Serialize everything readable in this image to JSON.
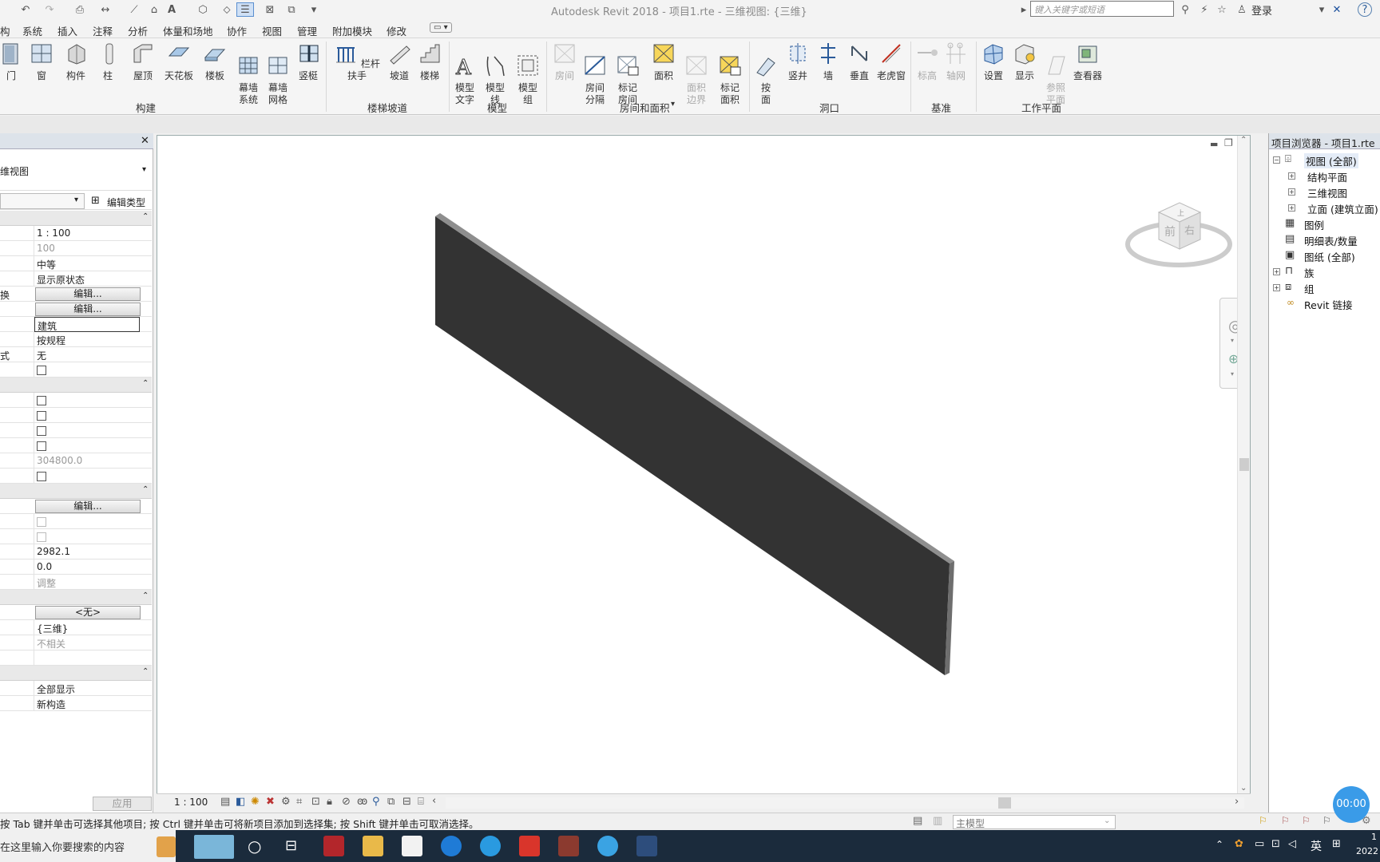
{
  "title_bar": {
    "text": "Autodesk Revit 2018 -    项目1.rte - 三维视图: {三维}",
    "search_placeholder": "键入关键字或短语",
    "login_label": "登录"
  },
  "menu_tabs": [
    "构",
    "系统",
    "插入",
    "注释",
    "分析",
    "体量和场地",
    "协作",
    "视图",
    "管理",
    "附加模块",
    "修改"
  ],
  "ribbon": {
    "build": {
      "title": "构建",
      "buttons": [
        "门",
        "窗",
        "构件",
        "柱",
        "屋顶",
        "天花板",
        "楼板",
        "幕墙\n系统",
        "幕墙\n网格",
        "竖梃"
      ]
    },
    "circulation": {
      "title": "楼梯坡道",
      "buttons": [
        "栏杆扶手",
        "坡道",
        "楼梯"
      ]
    },
    "model": {
      "title": "模型",
      "buttons": [
        "模型\n文字",
        "模型\n线",
        "模型\n组"
      ]
    },
    "room_area": {
      "title": "房间和面积",
      "buttons": [
        "房间",
        "房间\n分隔",
        "标记\n房间",
        "面积",
        "面积\n边界",
        "标记\n面积"
      ]
    },
    "opening": {
      "title": "洞口",
      "buttons": [
        "按\n面",
        "竖井",
        "墙",
        "垂直",
        "老虎窗"
      ]
    },
    "datum": {
      "title": "基准",
      "buttons": [
        "标高",
        "轴网"
      ]
    },
    "workplane": {
      "title": "工作平面",
      "buttons": [
        "设置",
        "显示",
        "参照\n平面",
        "查看器"
      ]
    }
  },
  "properties": {
    "type_selector": "维视图",
    "edit_type_label": "编辑类型",
    "apply_label": "应用",
    "rows": [
      {
        "kind": "group"
      },
      {
        "kind": "text",
        "label": "",
        "value": "1 : 100"
      },
      {
        "kind": "gray",
        "label": "",
        "value": "100"
      },
      {
        "kind": "text",
        "label": "",
        "value": "中等"
      },
      {
        "kind": "text",
        "label": "",
        "value": "显示原状态"
      },
      {
        "kind": "button",
        "label": "换",
        "value": "编辑..."
      },
      {
        "kind": "button",
        "label": "",
        "value": "编辑..."
      },
      {
        "kind": "input",
        "label": "",
        "value": "建筑"
      },
      {
        "kind": "text",
        "label": "",
        "value": "按规程"
      },
      {
        "kind": "text",
        "label": "式",
        "value": "无"
      },
      {
        "kind": "check",
        "label": ""
      },
      {
        "kind": "group"
      },
      {
        "kind": "check",
        "label": ""
      },
      {
        "kind": "check",
        "label": ""
      },
      {
        "kind": "check",
        "label": ""
      },
      {
        "kind": "check",
        "label": ""
      },
      {
        "kind": "gray",
        "label": "",
        "value": "304800.0"
      },
      {
        "kind": "check",
        "label": ""
      },
      {
        "kind": "group"
      },
      {
        "kind": "button",
        "label": "",
        "value": "编辑..."
      },
      {
        "kind": "checkdis",
        "label": ""
      },
      {
        "kind": "checkdis",
        "label": ""
      },
      {
        "kind": "text",
        "label": "",
        "value": "2982.1"
      },
      {
        "kind": "text",
        "label": "",
        "value": "0.0"
      },
      {
        "kind": "gray",
        "label": "",
        "value": "调整"
      },
      {
        "kind": "group"
      },
      {
        "kind": "button",
        "label": "",
        "value": "<无>"
      },
      {
        "kind": "text",
        "label": "",
        "value": "{三维}"
      },
      {
        "kind": "gray",
        "label": "",
        "value": "不相关"
      },
      {
        "kind": "text",
        "label": "",
        "value": ""
      },
      {
        "kind": "group"
      },
      {
        "kind": "text",
        "label": "",
        "value": "全部显示"
      },
      {
        "kind": "text",
        "label": "",
        "value": "新构造"
      }
    ]
  },
  "viewcube": {
    "top": "上",
    "front": "前",
    "right": "右"
  },
  "project_browser": {
    "title": "项目浏览器 - 项目1.rte",
    "items": [
      "视图 (全部)",
      "结构平面",
      "三维视图",
      "立面 (建筑立面)",
      "图例",
      "明细表/数量",
      "图纸 (全部)",
      "族",
      "组",
      "Revit 链接"
    ]
  },
  "view_control": {
    "scale": "1 : 100"
  },
  "status_bar": {
    "hint": "按 Tab 键并单击可选择其他项目; 按 Ctrl 键并单击可将新项目添加到选择集; 按 Shift 键并单击可取消选择。",
    "model": "主模型"
  },
  "taskbar": {
    "search": "在这里输入你要搜索的内容",
    "lang": "英",
    "clock_time": "1",
    "clock_date": "2022",
    "timer": "00:00"
  }
}
